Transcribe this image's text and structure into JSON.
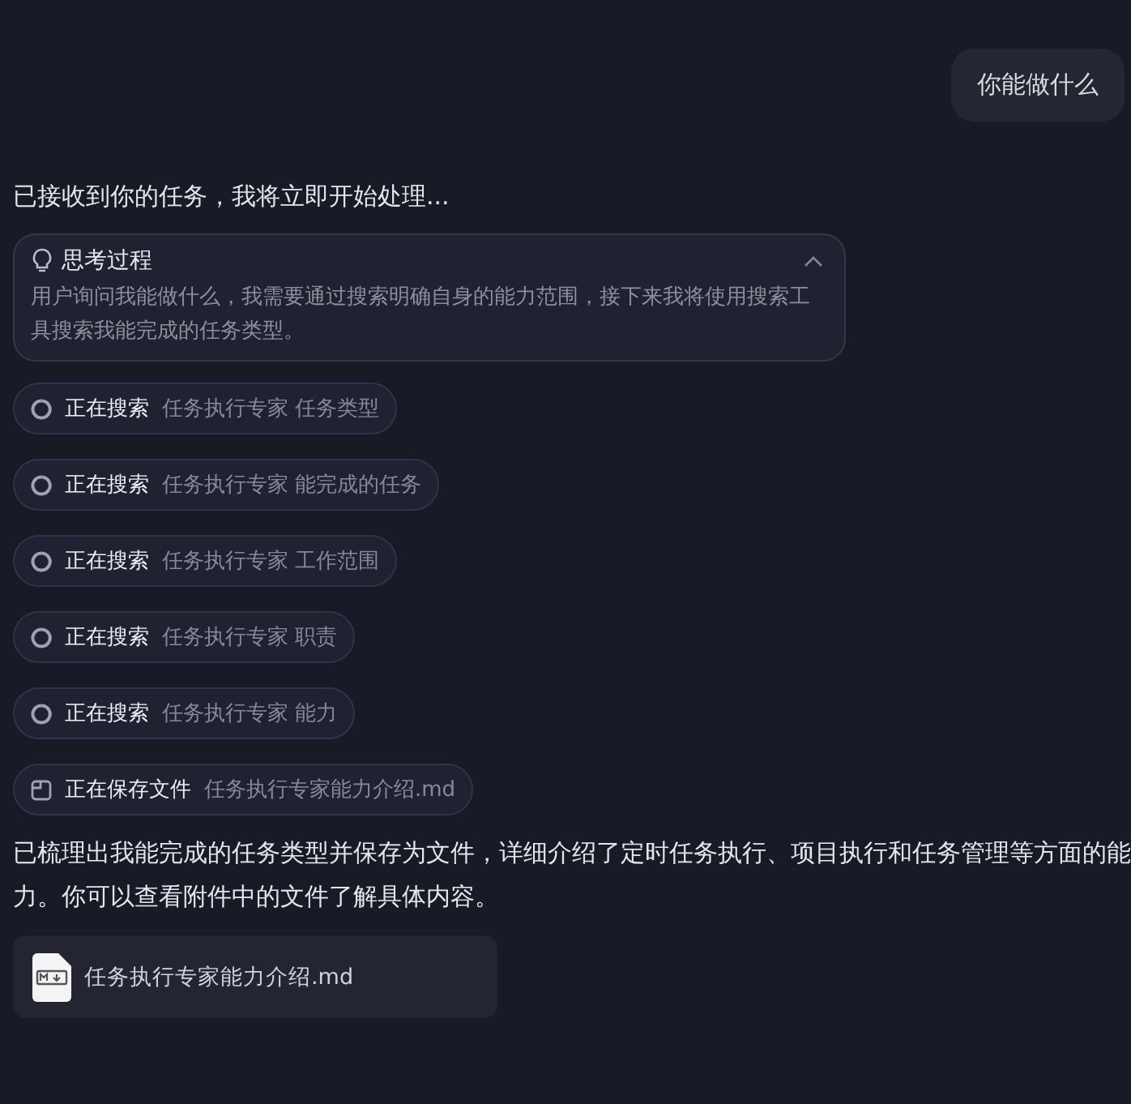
{
  "user_message": "你能做什么",
  "intro": "已接收到你的任务，我将立即开始处理...",
  "thinking": {
    "title": "思考过程",
    "expanded": true,
    "text": "用户询问我能做什么，我需要通过搜索明确自身的能力范围，接下来我将使用搜索工具搜索我能完成的任务类型。"
  },
  "steps": [
    {
      "kind": "search",
      "action": "正在搜索",
      "detail": "任务执行专家 任务类型"
    },
    {
      "kind": "search",
      "action": "正在搜索",
      "detail": "任务执行专家 能完成的任务"
    },
    {
      "kind": "search",
      "action": "正在搜索",
      "detail": "任务执行专家 工作范围"
    },
    {
      "kind": "search",
      "action": "正在搜索",
      "detail": "任务执行专家 职责"
    },
    {
      "kind": "search",
      "action": "正在搜索",
      "detail": "任务执行专家 能力"
    },
    {
      "kind": "save",
      "action": "正在保存文件",
      "detail": "任务执行专家能力介绍.md"
    }
  ],
  "summary": "已梳理出我能完成的任务类型并保存为文件，详细介绍了定时任务执行、项目执行和任务管理等方面的能力。你可以查看附件中的文件了解具体内容。",
  "attachment": {
    "name": "任务执行专家能力介绍.md"
  }
}
